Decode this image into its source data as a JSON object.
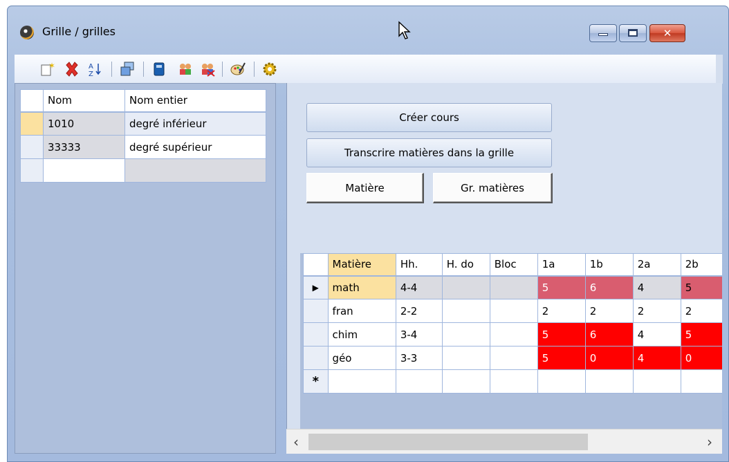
{
  "window": {
    "title": "Grille / grilles"
  },
  "left_grid": {
    "headers": [
      "Nom",
      "Nom entier"
    ],
    "rows": [
      {
        "nom": "1010",
        "nom_entier": "degré inférieur"
      },
      {
        "nom": "33333",
        "nom_entier": "degré supérieur"
      }
    ]
  },
  "right": {
    "btn_creer": "Créer cours",
    "btn_transcrire": "Transcrire matières dans la grille",
    "btn_matiere": "Matière",
    "btn_gr_matieres": "Gr. matières"
  },
  "subject_grid": {
    "headers": [
      "Matière",
      "Hh.",
      "H. do",
      "Bloc",
      "1a",
      "1b",
      "2a",
      "2b"
    ],
    "rows": [
      {
        "matiere": "math",
        "hh": "4-4",
        "c1a": "5",
        "c1b": "6",
        "c2a": "4",
        "c2b": "5"
      },
      {
        "matiere": "fran",
        "hh": "2-2",
        "c1a": "2",
        "c1b": "2",
        "c2a": "2",
        "c2b": "2"
      },
      {
        "matiere": "chim",
        "hh": "3-4",
        "c1a": "5",
        "c1b": "6",
        "c2a": "4",
        "c2b": "5"
      },
      {
        "matiere": "géo",
        "hh": "3-3",
        "c1a": "5",
        "c1b": "0",
        "c2a": "4",
        "c2b": "0"
      }
    ],
    "new_row_marker": "*",
    "current_row_marker": "▶"
  },
  "colors": {
    "highlight_red": "#ff0000",
    "highlight_pink": "#d95d6f",
    "selection": "#fbe1a0"
  }
}
